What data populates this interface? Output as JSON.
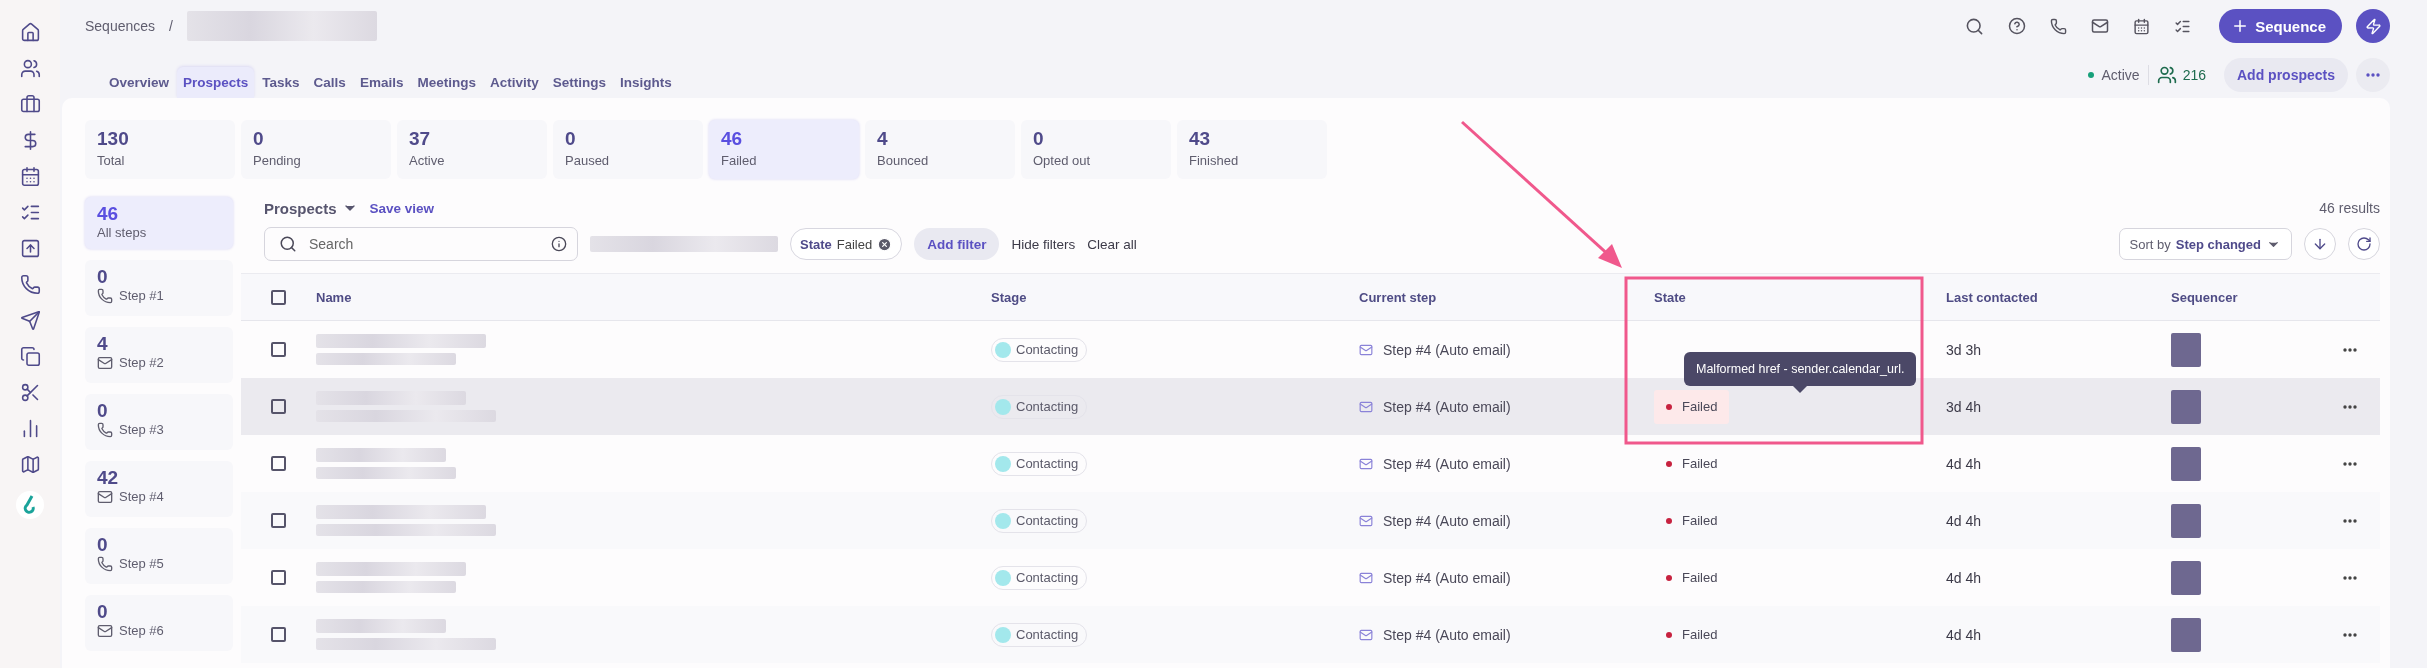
{
  "breadcrumb": {
    "root": "Sequences",
    "separator": "/"
  },
  "header": {
    "new_button": "Sequence",
    "status": "Active",
    "active": true,
    "prospect_count": "216",
    "add_button": "Add prospects"
  },
  "tabs": [
    {
      "label": "Overview",
      "selected": false
    },
    {
      "label": "Prospects",
      "selected": true
    },
    {
      "label": "Tasks",
      "selected": false
    },
    {
      "label": "Calls",
      "selected": false
    },
    {
      "label": "Emails",
      "selected": false
    },
    {
      "label": "Meetings",
      "selected": false
    },
    {
      "label": "Activity",
      "selected": false
    },
    {
      "label": "Settings",
      "selected": false
    },
    {
      "label": "Insights",
      "selected": false
    }
  ],
  "stats": [
    {
      "value": "130",
      "label": "Total",
      "selected": false
    },
    {
      "value": "0",
      "label": "Pending",
      "selected": false
    },
    {
      "value": "37",
      "label": "Active",
      "selected": false
    },
    {
      "value": "0",
      "label": "Paused",
      "selected": false
    },
    {
      "value": "46",
      "label": "Failed",
      "selected": true
    },
    {
      "value": "4",
      "label": "Bounced",
      "selected": false
    },
    {
      "value": "0",
      "label": "Opted out",
      "selected": false
    },
    {
      "value": "43",
      "label": "Finished",
      "selected": false
    }
  ],
  "all_steps": {
    "value": "46",
    "label": "All steps",
    "selected": true
  },
  "steps": [
    {
      "value": "0",
      "label": "Step #1",
      "kind": "call",
      "selected": false
    },
    {
      "value": "4",
      "label": "Step #2",
      "kind": "email",
      "selected": false
    },
    {
      "value": "0",
      "label": "Step #3",
      "kind": "call",
      "selected": false
    },
    {
      "value": "42",
      "label": "Step #4",
      "kind": "email",
      "selected": false
    },
    {
      "value": "0",
      "label": "Step #5",
      "kind": "call",
      "selected": false
    },
    {
      "value": "0",
      "label": "Step #6",
      "kind": "email",
      "selected": false
    }
  ],
  "toolbar": {
    "view": "Prospects",
    "save_view": "Save view",
    "search_placeholder": "Search",
    "filter_field": "State",
    "filter_value": "Failed",
    "add_filter": "Add filter",
    "hide_filters": "Hide filters",
    "clear_all": "Clear all",
    "results": "46 results",
    "sort_label": "Sort by",
    "sort_value": "Step changed"
  },
  "table": {
    "select_all_checked": false,
    "columns": [
      "Name",
      "Stage",
      "Current step",
      "State",
      "Last contacted",
      "Sequencer"
    ],
    "rows": [
      {
        "checked": false,
        "stage": "Contacting",
        "step": "Step #4 (Auto email)",
        "last_contacted": "3d 3h",
        "hovered": false
      },
      {
        "checked": false,
        "stage": "Contacting",
        "step": "Step #4 (Auto email)",
        "state": "Failed",
        "last_contacted": "3d 4h",
        "hovered": true,
        "tooltip": "Malformed href - sender.calendar_url."
      },
      {
        "checked": false,
        "stage": "Contacting",
        "step": "Step #4 (Auto email)",
        "state": "Failed",
        "last_contacted": "4d 4h",
        "hovered": false
      },
      {
        "checked": false,
        "stage": "Contacting",
        "step": "Step #4 (Auto email)",
        "state": "Failed",
        "last_contacted": "4d 4h",
        "hovered": false
      },
      {
        "checked": false,
        "stage": "Contacting",
        "step": "Step #4 (Auto email)",
        "state": "Failed",
        "last_contacted": "4d 4h",
        "hovered": false
      },
      {
        "checked": false,
        "stage": "Contacting",
        "step": "Step #4 (Auto email)",
        "state": "Failed",
        "last_contacted": "4d 4h",
        "hovered": false
      }
    ]
  }
}
